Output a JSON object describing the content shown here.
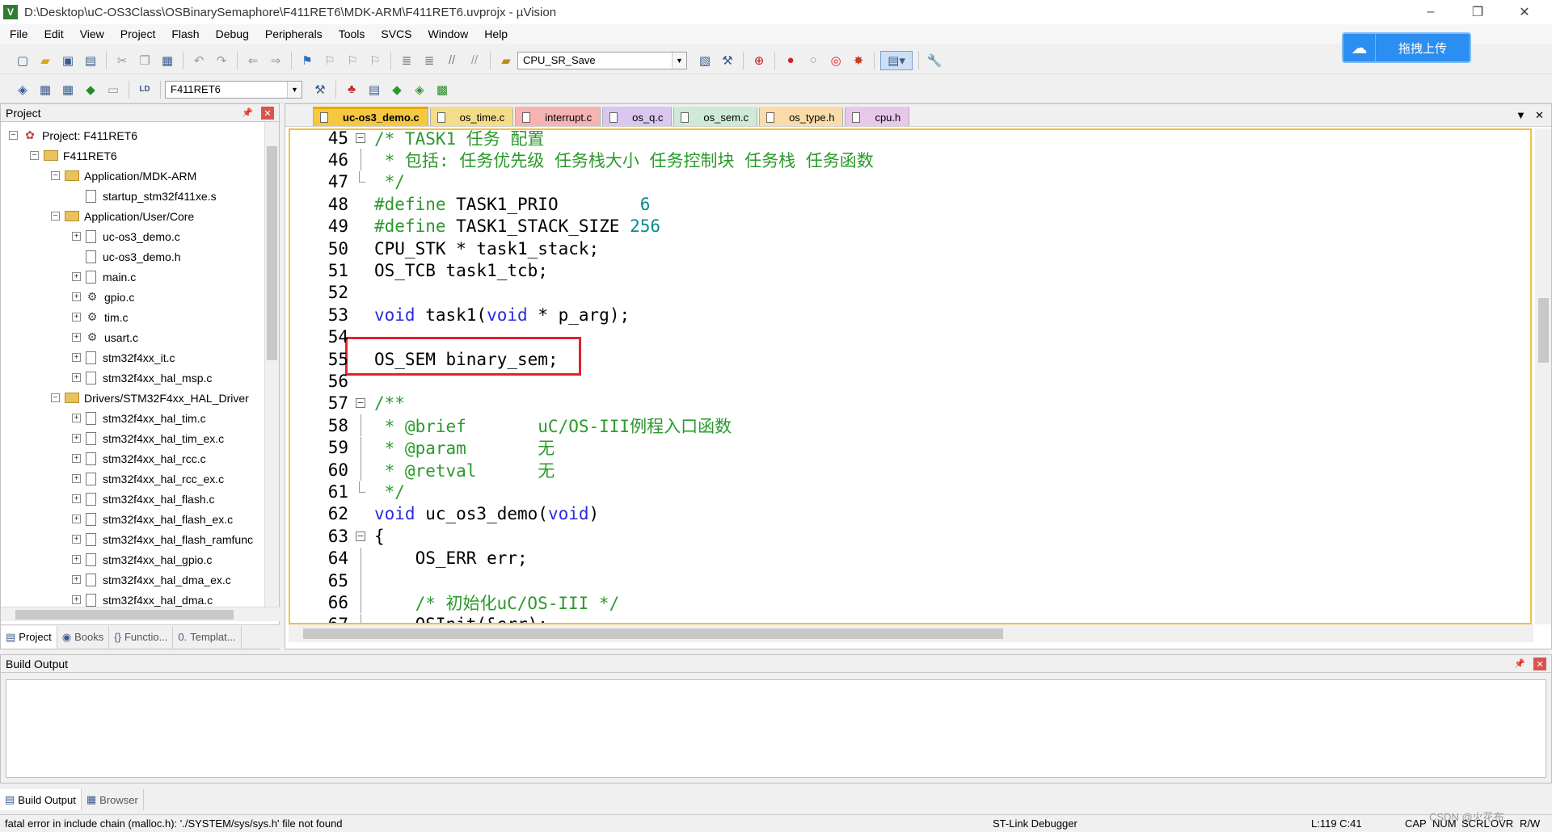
{
  "window": {
    "title": "D:\\Desktop\\uC-OS3Class\\OSBinarySemaphore\\F411RET6\\MDK-ARM\\F411RET6.uvprojx - µVision",
    "app_icon": "V",
    "minimize": "–",
    "restore": "❐",
    "close": "✕"
  },
  "menu": [
    "File",
    "Edit",
    "View",
    "Project",
    "Flash",
    "Debug",
    "Peripherals",
    "Tools",
    "SVCS",
    "Window",
    "Help"
  ],
  "toolbar1": {
    "find_combo": "CPU_SR_Save"
  },
  "toolbar2": {
    "target_combo": "F411RET6"
  },
  "upload_button": {
    "label": "拖拽上传"
  },
  "project_panel": {
    "title": "Project",
    "tree": [
      {
        "label": "Project: F411RET6",
        "level": 0,
        "icon": "project",
        "expander": "−"
      },
      {
        "label": "F411RET6",
        "level": 1,
        "icon": "folder",
        "expander": "−"
      },
      {
        "label": "Application/MDK-ARM",
        "level": 2,
        "icon": "folder",
        "expander": "−"
      },
      {
        "label": "startup_stm32f411xe.s",
        "level": 3,
        "icon": "file",
        "expander": ""
      },
      {
        "label": "Application/User/Core",
        "level": 2,
        "icon": "folder",
        "expander": "−"
      },
      {
        "label": "uc-os3_demo.c",
        "level": 3,
        "icon": "file",
        "expander": "+"
      },
      {
        "label": "uc-os3_demo.h",
        "level": 3,
        "icon": "file",
        "expander": ""
      },
      {
        "label": "main.c",
        "level": 3,
        "icon": "file",
        "expander": "+"
      },
      {
        "label": "gpio.c",
        "level": 3,
        "icon": "gear",
        "expander": "+"
      },
      {
        "label": "tim.c",
        "level": 3,
        "icon": "gear",
        "expander": "+"
      },
      {
        "label": "usart.c",
        "level": 3,
        "icon": "gear",
        "expander": "+"
      },
      {
        "label": "stm32f4xx_it.c",
        "level": 3,
        "icon": "file",
        "expander": "+"
      },
      {
        "label": "stm32f4xx_hal_msp.c",
        "level": 3,
        "icon": "file",
        "expander": "+"
      },
      {
        "label": "Drivers/STM32F4xx_HAL_Driver",
        "level": 2,
        "icon": "folder",
        "expander": "−"
      },
      {
        "label": "stm32f4xx_hal_tim.c",
        "level": 3,
        "icon": "file",
        "expander": "+"
      },
      {
        "label": "stm32f4xx_hal_tim_ex.c",
        "level": 3,
        "icon": "file",
        "expander": "+"
      },
      {
        "label": "stm32f4xx_hal_rcc.c",
        "level": 3,
        "icon": "file",
        "expander": "+"
      },
      {
        "label": "stm32f4xx_hal_rcc_ex.c",
        "level": 3,
        "icon": "file",
        "expander": "+"
      },
      {
        "label": "stm32f4xx_hal_flash.c",
        "level": 3,
        "icon": "file",
        "expander": "+"
      },
      {
        "label": "stm32f4xx_hal_flash_ex.c",
        "level": 3,
        "icon": "file",
        "expander": "+"
      },
      {
        "label": "stm32f4xx_hal_flash_ramfunc",
        "level": 3,
        "icon": "file",
        "expander": "+"
      },
      {
        "label": "stm32f4xx_hal_gpio.c",
        "level": 3,
        "icon": "file",
        "expander": "+"
      },
      {
        "label": "stm32f4xx_hal_dma_ex.c",
        "level": 3,
        "icon": "file",
        "expander": "+"
      },
      {
        "label": "stm32f4xx_hal_dma.c",
        "level": 3,
        "icon": "file",
        "expander": "+"
      }
    ],
    "tabs": [
      {
        "label": "Project",
        "icon": "▤",
        "active": true
      },
      {
        "label": "Books",
        "icon": "◉",
        "active": false
      },
      {
        "label": "Functio...",
        "icon": "{}",
        "active": false
      },
      {
        "label": "Templat...",
        "icon": "0.",
        "active": false
      }
    ]
  },
  "editor": {
    "tabs": [
      {
        "label": "uc-os3_demo.c",
        "color": "#f5c842",
        "active": true
      },
      {
        "label": "os_time.c",
        "color": "#f3dc8a",
        "active": false
      },
      {
        "label": "interrupt.c",
        "color": "#f6b3b3",
        "active": false
      },
      {
        "label": "os_q.c",
        "color": "#d9c7ef",
        "active": false
      },
      {
        "label": "os_sem.c",
        "color": "#cfe9d7",
        "active": false
      },
      {
        "label": "os_type.h",
        "color": "#fadcaa",
        "active": false
      },
      {
        "label": "cpu.h",
        "color": "#e7c8ea",
        "active": false
      }
    ],
    "lines": [
      {
        "n": "45",
        "fold": "open",
        "segs": [
          {
            "t": "/* TASK1 任务 配置",
            "c": "cm"
          }
        ]
      },
      {
        "n": "46",
        "fold": "line",
        "segs": [
          {
            "t": " * 包括: 任务优先级 任务栈大小 任务控制块 任务栈 任务函数",
            "c": "cm"
          }
        ]
      },
      {
        "n": "47",
        "fold": "end",
        "segs": [
          {
            "t": " */",
            "c": "cm"
          }
        ]
      },
      {
        "n": "48",
        "fold": "",
        "segs": [
          {
            "t": "#define",
            "c": "pp"
          },
          {
            "t": " TASK1_PRIO        ",
            "c": "tx"
          },
          {
            "t": "6",
            "c": "num"
          }
        ]
      },
      {
        "n": "49",
        "fold": "",
        "segs": [
          {
            "t": "#define",
            "c": "pp"
          },
          {
            "t": " TASK1_STACK_SIZE ",
            "c": "tx"
          },
          {
            "t": "256",
            "c": "num"
          }
        ]
      },
      {
        "n": "50",
        "fold": "",
        "segs": [
          {
            "t": "CPU_STK * task1_stack;",
            "c": "tx"
          }
        ]
      },
      {
        "n": "51",
        "fold": "",
        "segs": [
          {
            "t": "OS_TCB task1_tcb;",
            "c": "tx"
          }
        ]
      },
      {
        "n": "52",
        "fold": "",
        "segs": []
      },
      {
        "n": "53",
        "fold": "",
        "segs": [
          {
            "t": "void",
            "c": "kw"
          },
          {
            "t": " task1(",
            "c": "tx"
          },
          {
            "t": "void",
            "c": "kw"
          },
          {
            "t": " * p_arg);",
            "c": "tx"
          }
        ]
      },
      {
        "n": "54",
        "fold": "",
        "segs": []
      },
      {
        "n": "55",
        "fold": "",
        "segs": [
          {
            "t": "OS_SEM binary_sem;",
            "c": "tx"
          }
        ]
      },
      {
        "n": "56",
        "fold": "",
        "segs": []
      },
      {
        "n": "57",
        "fold": "open",
        "segs": [
          {
            "t": "/**",
            "c": "cm"
          }
        ]
      },
      {
        "n": "58",
        "fold": "line",
        "segs": [
          {
            "t": " * @brief       uC/OS-III例程入口函数",
            "c": "cm"
          }
        ]
      },
      {
        "n": "59",
        "fold": "line",
        "segs": [
          {
            "t": " * @param       无",
            "c": "cm"
          }
        ]
      },
      {
        "n": "60",
        "fold": "line",
        "segs": [
          {
            "t": " * @retval      无",
            "c": "cm"
          }
        ]
      },
      {
        "n": "61",
        "fold": "end",
        "segs": [
          {
            "t": " */",
            "c": "cm"
          }
        ]
      },
      {
        "n": "62",
        "fold": "",
        "segs": [
          {
            "t": "void",
            "c": "kw"
          },
          {
            "t": " uc_os3_demo(",
            "c": "tx"
          },
          {
            "t": "void",
            "c": "kw"
          },
          {
            "t": ")",
            "c": "tx"
          }
        ]
      },
      {
        "n": "63",
        "fold": "open",
        "segs": [
          {
            "t": "{",
            "c": "tx"
          }
        ]
      },
      {
        "n": "64",
        "fold": "line",
        "segs": [
          {
            "t": "    OS_ERR err;",
            "c": "tx"
          }
        ]
      },
      {
        "n": "65",
        "fold": "line",
        "segs": []
      },
      {
        "n": "66",
        "fold": "line",
        "segs": [
          {
            "t": "    /* 初始化uC/OS-III */",
            "c": "cm"
          }
        ]
      },
      {
        "n": "67",
        "fold": "line",
        "segs": [
          {
            "t": "    OSInit(&err);",
            "c": "tx"
          }
        ]
      }
    ]
  },
  "build_output": {
    "title": "Build Output"
  },
  "bottom_tabs": [
    {
      "label": "Build Output",
      "icon": "▤",
      "active": true
    },
    {
      "label": "Browser",
      "icon": "▦",
      "active": false
    }
  ],
  "status": {
    "message": "fatal error in include chain (malloc.h): './SYSTEM/sys/sys.h' file not found",
    "debugger": "ST-Link Debugger",
    "position": "L:119 C:41",
    "caps": "CAP",
    "num": "NUM",
    "scrl": "SCRL",
    "ovr": "OVR",
    "rw": "R/W",
    "watermark": "CSDN @火花布"
  }
}
